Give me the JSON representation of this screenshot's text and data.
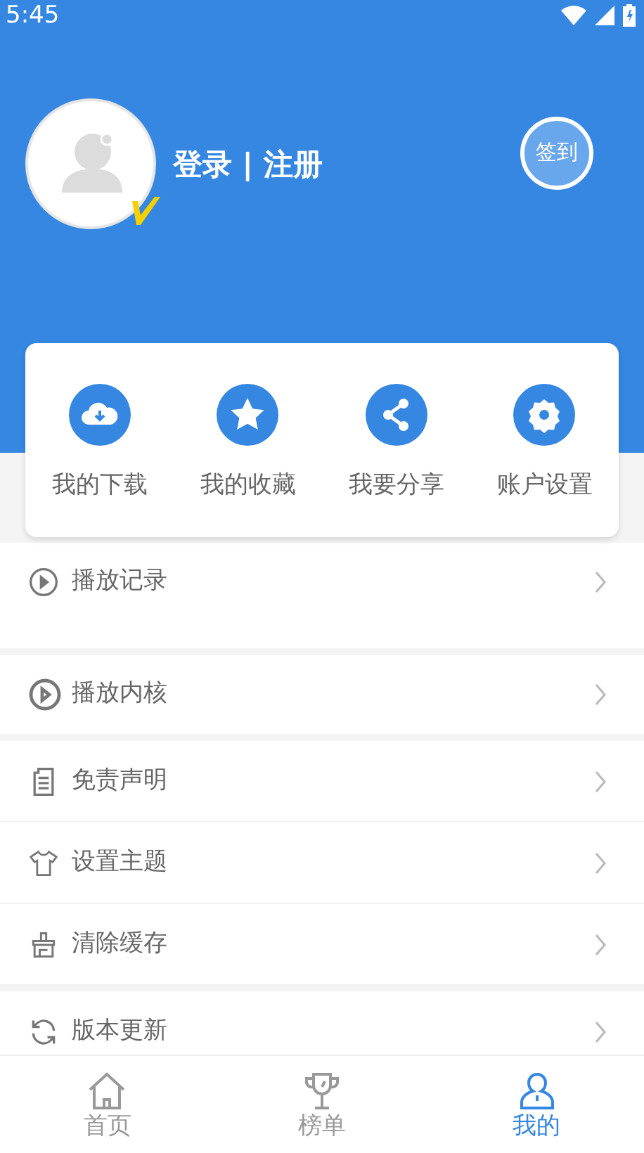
{
  "status_bar": {
    "time": "5:45"
  },
  "profile": {
    "login_text": "登录 | 注册",
    "sign_in_button": "签到"
  },
  "quick_actions": [
    {
      "kind": "download",
      "label": "我的下载"
    },
    {
      "kind": "star",
      "label": "我的收藏"
    },
    {
      "kind": "share",
      "label": "我要分享"
    },
    {
      "kind": "settings",
      "label": "账户设置"
    }
  ],
  "menu_groups": [
    {
      "items": [
        {
          "kind": "history",
          "label": "播放记录"
        }
      ]
    },
    {
      "items": [
        {
          "kind": "player",
          "label": "播放内核"
        }
      ]
    },
    {
      "items": [
        {
          "kind": "disclaimer",
          "label": "免责声明"
        },
        {
          "kind": "theme",
          "label": "设置主题"
        },
        {
          "kind": "cache",
          "label": "清除缓存"
        }
      ]
    },
    {
      "items": [
        {
          "kind": "update",
          "label": "版本更新"
        }
      ]
    }
  ],
  "bottom_nav": [
    {
      "kind": "home",
      "label": "首页",
      "selected": false
    },
    {
      "kind": "ranking",
      "label": "榜单",
      "selected": false
    },
    {
      "kind": "mine",
      "label": "我的",
      "selected": true
    }
  ]
}
